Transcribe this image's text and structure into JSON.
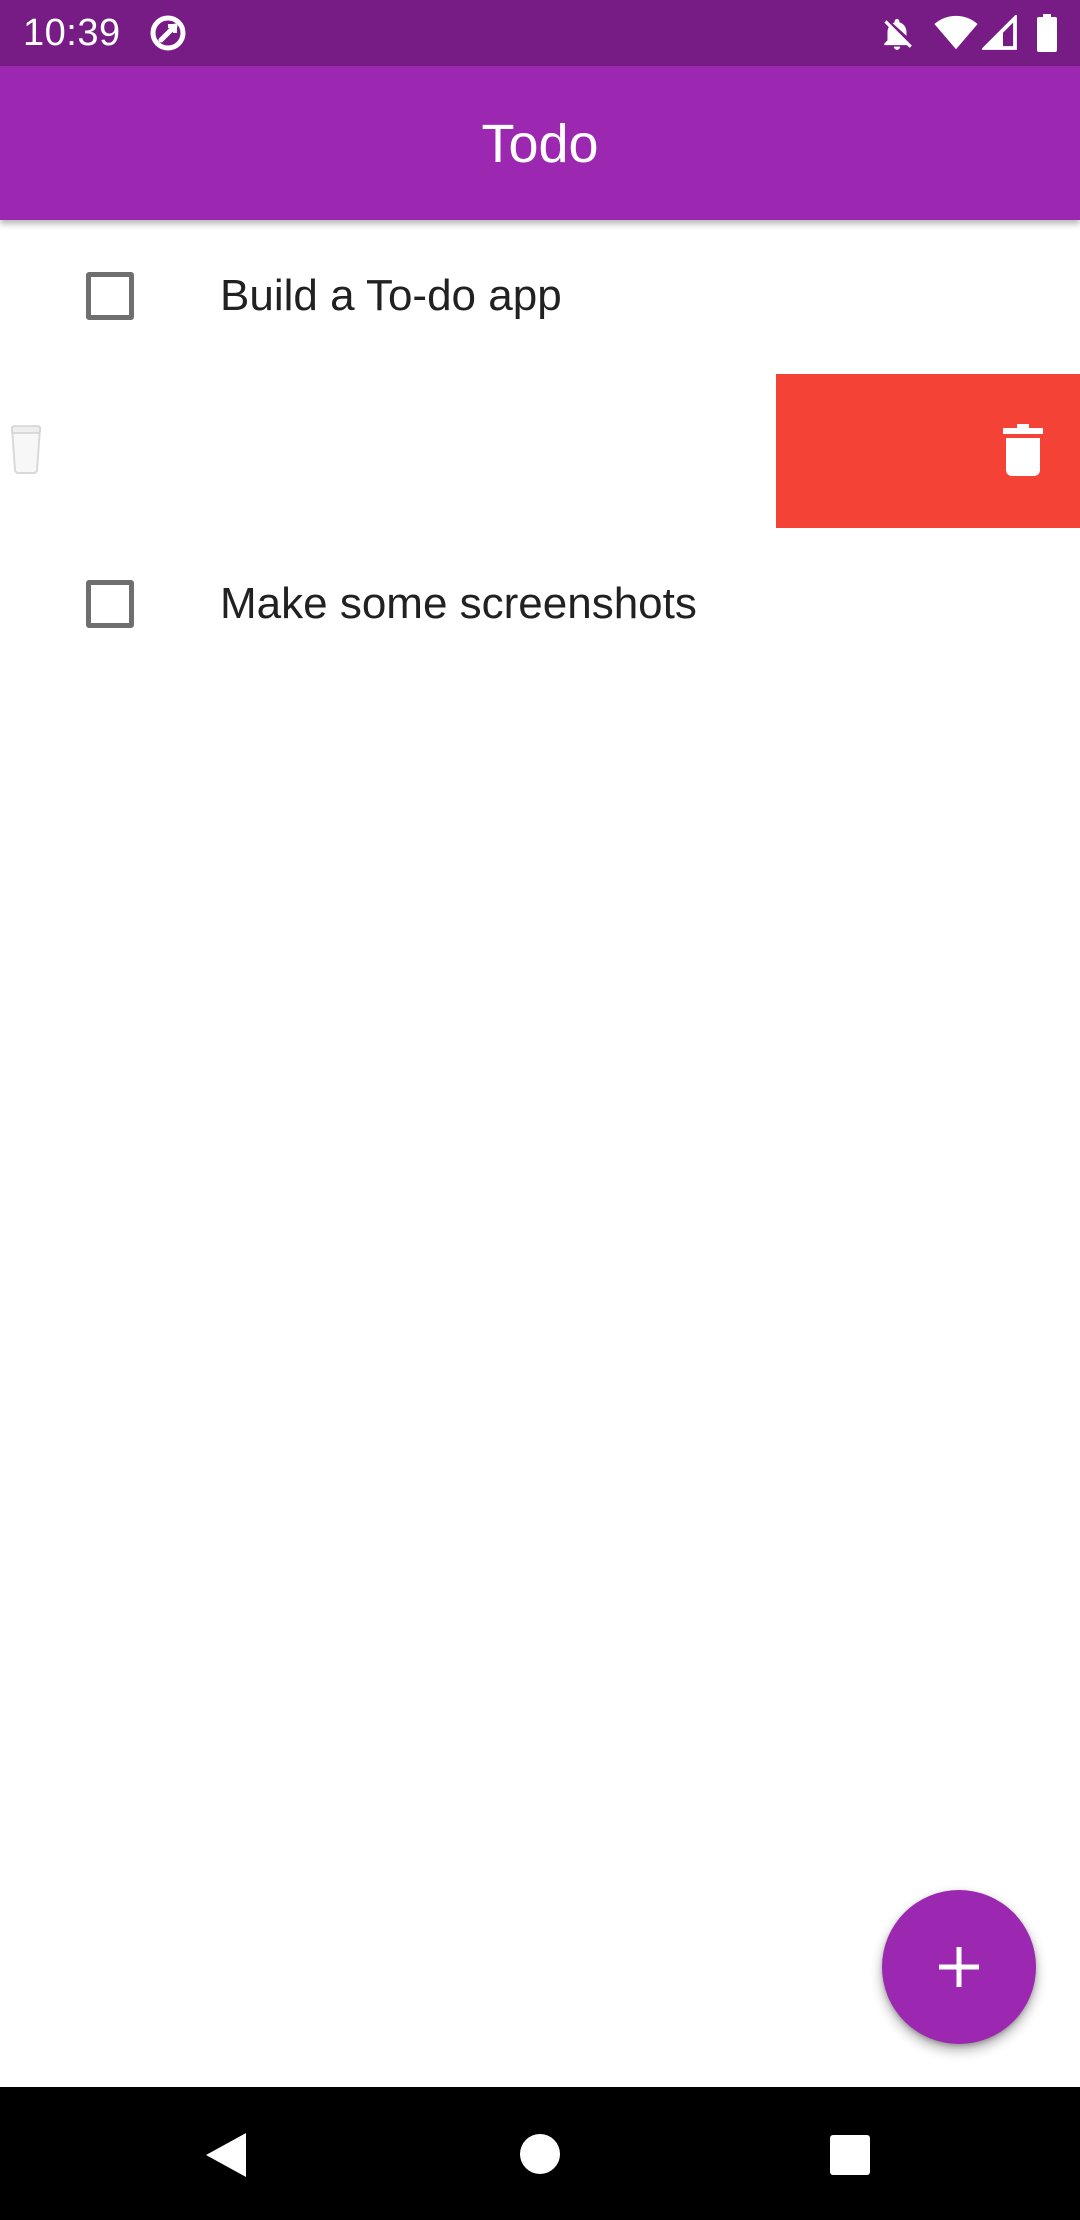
{
  "status_bar": {
    "time": "10:39",
    "icons": [
      "app-notification-icon",
      "bell-off-icon",
      "wifi-icon",
      "cell-signal-icon",
      "battery-icon"
    ]
  },
  "app_bar": {
    "title": "Todo"
  },
  "todos": [
    {
      "label": "Build a To-do app",
      "checked": false
    },
    {
      "label": "Make some screenshots",
      "checked": false
    }
  ],
  "swipe_to_delete": {
    "icon": "delete-icon",
    "background_color": "#f44336"
  },
  "fab": {
    "icon": "add-icon"
  },
  "nav_bar": {
    "icons": [
      "back-icon",
      "home-icon",
      "recents-icon"
    ]
  },
  "colors": {
    "primary": "#9c27b0",
    "status_bar": "#771c84",
    "delete": "#f44336"
  }
}
